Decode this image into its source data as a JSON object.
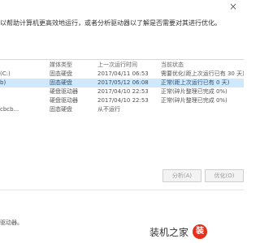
{
  "window": {
    "close_icon": "×"
  },
  "description": "以帮助计算机更高效地运行，或者分析驱动器以了解是否需要对其进行优化。",
  "status_label": "",
  "table": {
    "headers": [
      "",
      "媒体类型",
      "上一次运行时间",
      "当前状态"
    ],
    "rows": [
      {
        "name": "(C:)",
        "media": "固态硬盘",
        "time": "2017/04/11 06:53",
        "status": "需要优化(距上次运行已有 30 天)",
        "selected": false
      },
      {
        "name": "b)",
        "media": "固态硬盘",
        "time": "2017/05/12 06:08",
        "status": "正常(距上次运行已有 0 天)",
        "selected": true
      },
      {
        "name": "",
        "media": "硬盘驱动器",
        "time": "2017/04/10 22:53",
        "status": "正常(碎片整理已完成 0%)",
        "selected": false
      },
      {
        "name": "",
        "media": "硬盘驱动器",
        "time": "2017/04/10 22:53",
        "status": "正常(碎片整理已完成 0%)",
        "selected": false
      },
      {
        "name": "cbcb...",
        "media": "固态硬盘",
        "time": "从不运行",
        "status": "",
        "selected": false
      }
    ]
  },
  "buttons": {
    "analyze": "分析(A)",
    "optimize": "优化(O)"
  },
  "footer": {
    "text": "驱动器。"
  },
  "watermark": {
    "text": "装机之家",
    "logo_text": "装"
  }
}
